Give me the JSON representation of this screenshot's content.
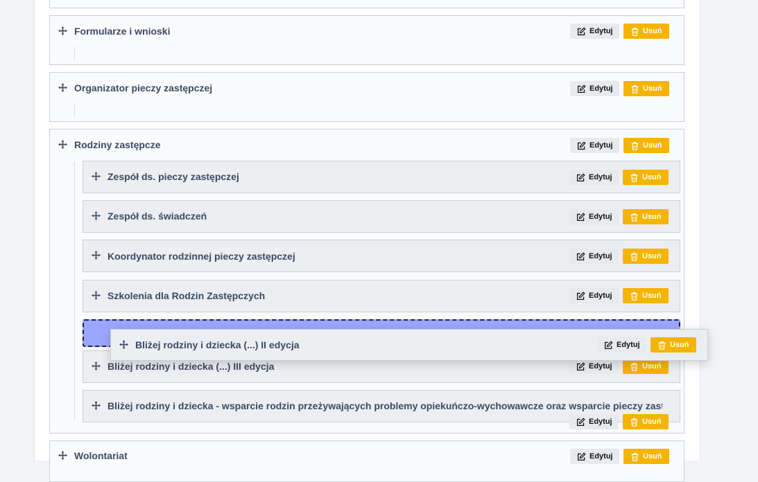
{
  "labels": {
    "edit": "Edytuj",
    "delete": "Usuń"
  },
  "colors": {
    "delete_button": "#f5b400",
    "edit_button": "#e8eaee",
    "drop_placeholder": "#9ba7ff",
    "title_text": "#3a4a63"
  },
  "items": {
    "formularze": "Formularze i wnioski",
    "organizator": "Organizator pieczy zastępczej",
    "rodziny": "Rodziny zastępcze",
    "wolontariat": "Wolontariat"
  },
  "children": {
    "zespol_pieczy": "Zespół ds. pieczy zastępczej",
    "zespol_swiadczen": "Zespół ds. świadczeń",
    "koordynator": "Koordynator rodzinnej pieczy zastępczej",
    "szkolenia": "Szkolenia dla Rodzin Zastępczych",
    "blizej_iii": "Bliżej rodziny i dziecka (...) III edycja",
    "blizej_wsparcie": "Bliżej rodziny i dziecka - wsparcie rodzin przeżywających problemy opiekuńczo-wychowawcze oraz wsparcie pieczy zastępcze"
  },
  "dragged": {
    "title": "Bliżej rodziny i dziecka (...) II edycja"
  },
  "icons": {
    "move": "move-arrows-icon",
    "edit": "edit-pencil-icon",
    "delete": "trash-icon"
  }
}
